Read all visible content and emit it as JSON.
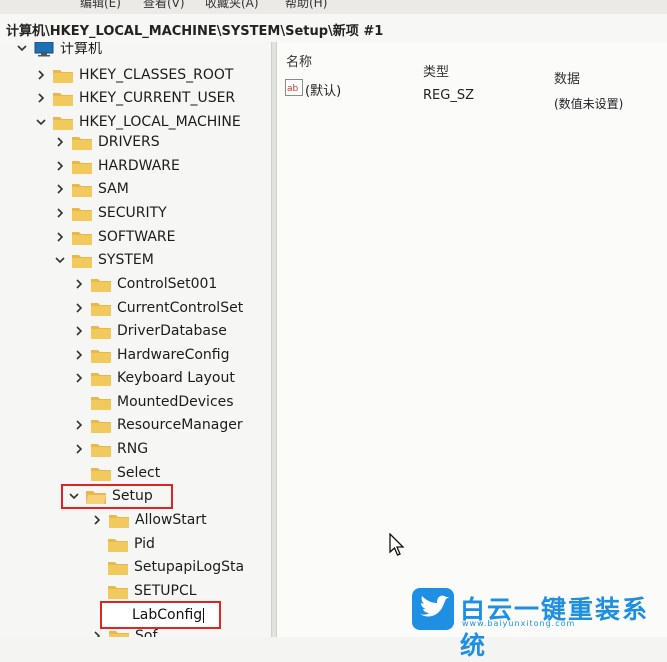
{
  "menu": {
    "items": [
      "编辑(E)",
      "查看(V)",
      "收藏夹(A)",
      "帮助(H)"
    ]
  },
  "address": {
    "path": "计算机\\HKEY_LOCAL_MACHINE\\SYSTEM\\Setup\\新项 #1"
  },
  "tree": {
    "root": "计算机",
    "hkcr": "HKEY_CLASSES_ROOT",
    "hkcu": "HKEY_CURRENT_USER",
    "hklm": "HKEY_LOCAL_MACHINE",
    "drivers": "DRIVERS",
    "hardware": "HARDWARE",
    "sam": "SAM",
    "security": "SECURITY",
    "software": "SOFTWARE",
    "system": "SYSTEM",
    "controlset001": "ControlSet001",
    "currentcontrolset": "CurrentControlSet",
    "driverdatabase": "DriverDatabase",
    "hardwareconfig": "HardwareConfig",
    "keyboardlayout": "Keyboard Layout",
    "mounteddevices": "MountedDevices",
    "resourcemanager": "ResourceManager",
    "rng": "RNG",
    "select": "Select",
    "setup": "Setup",
    "allowstart": "AllowStart",
    "pid": "Pid",
    "setupapilog": "SetupapiLogSta",
    "setupcl": "SETUPCL",
    "labconfig": "LabConfig",
    "partial": "Sof"
  },
  "values_pane": {
    "headers": {
      "name": "名称",
      "type": "类型",
      "data": "数据"
    },
    "rows": [
      {
        "name": "(默认)",
        "type": "REG_SZ",
        "data": "(数值未设置)"
      }
    ]
  },
  "watermark": {
    "title": "白云一键重装系统",
    "url": "www.baiyunxitong.com"
  },
  "colors": {
    "folder": "#e8b84a",
    "highlight_box": "#e02424",
    "watermark": "#1e8fe3"
  }
}
